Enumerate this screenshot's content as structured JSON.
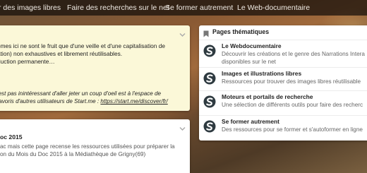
{
  "nav": {
    "links": [
      "r des images libres",
      "Faire des recherches sur le net",
      "Se former autrement",
      "Le Web-documentaire"
    ]
  },
  "note": {
    "lines": [
      "emes ici ne sont le fruit que d'une veille et d'une capitalisation de",
      "ation) non exhaustives et librement réutilisables.",
      "duction permanente…"
    ],
    "italic_lines": [
      "'est pas inintéressant d'aller jeter un coup d'oeil est à l'espace de",
      "favoris d'autres utilisateurs de Start.me : "
    ],
    "link": "https://start.me/discover/fr/"
  },
  "doc": {
    "title": "oc 2015",
    "lines": [
      "ac mais cette page recense les ressources utilisées pour préparer la",
      "on du Mois du Doc 2015 à la Médiathèque de Grigny(69)"
    ]
  },
  "pages": {
    "title": "Pages thématiques",
    "items": [
      {
        "title": "Le Webdocumentaire",
        "desc": [
          "Découvrir les créations et le genre des Narrations Intera",
          "disponibles sur le net"
        ]
      },
      {
        "title": "Images et illustrations libres",
        "desc": [
          "Ressources pour trouver des images libres réutilisable"
        ]
      },
      {
        "title": "Moteurs et portails de recherche",
        "desc": [
          "Une sélection de différents outils pour faire des recherc"
        ]
      },
      {
        "title": "Se former autrement",
        "desc": [
          "Des ressources pour se former et s'autoformer en ligne"
        ]
      }
    ]
  },
  "colors": {
    "nav_bg": "#1e140e",
    "note_bg": "#fbf8d8",
    "logo": "#2e3a40"
  },
  "icons": {
    "chevron": "chevron-down-icon",
    "bookmark": "bookmark-icon",
    "item_logo": "startme-logo-icon"
  }
}
